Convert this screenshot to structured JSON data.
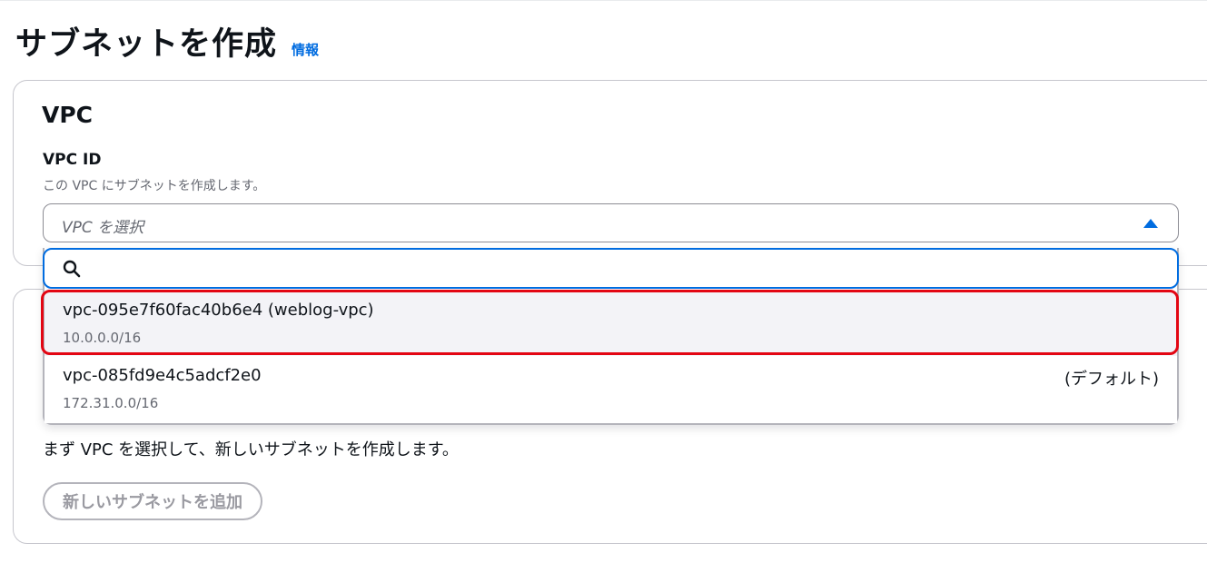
{
  "header": {
    "title": "サブネットを作成",
    "info_link": "情報"
  },
  "vpc_section": {
    "title": "VPC",
    "field_label": "VPC ID",
    "field_description": "この VPC にサブネットを作成します。",
    "select_placeholder": "VPC を選択",
    "search_value": "",
    "options": [
      {
        "id": "vpc-095e7f60fac40b6e4 (weblog-vpc)",
        "cidr": "10.0.0.0/16",
        "tag": ""
      },
      {
        "id": "vpc-085fd9e4c5adcf2e0",
        "cidr": "172.31.0.0/16",
        "tag": "(デフォルト)"
      }
    ]
  },
  "subnet_section": {
    "empty_text": "まず VPC を選択して、新しいサブネットを作成します。",
    "add_button_label": "新しいサブネットを追加"
  },
  "colors": {
    "accent": "#006ce0",
    "highlight": "#e30613",
    "selected_bg": "#f3f3f7"
  }
}
